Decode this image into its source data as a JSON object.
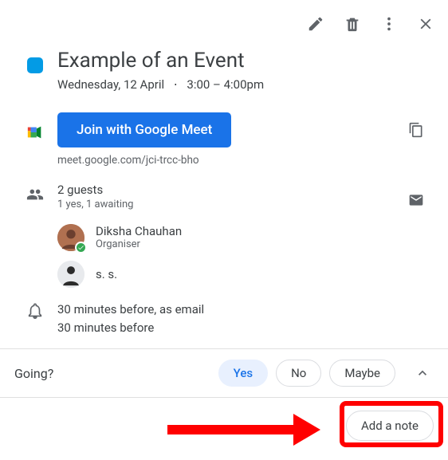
{
  "colors": {
    "event": "#039be5"
  },
  "event": {
    "title": "Example of an Event",
    "date": "Wednesday, 12 April",
    "time": "3:00 – 4:00pm"
  },
  "meet": {
    "join_label": "Join with Google Meet",
    "link": "meet.google.com/jci-trcc-bho"
  },
  "guests": {
    "count_line": "2 guests",
    "status_line": "1 yes, 1 awaiting",
    "items": [
      {
        "name": "Diksha Chauhan",
        "role": "Organiser",
        "response": "yes"
      },
      {
        "name": "s. s.",
        "role": "",
        "response": "awaiting"
      }
    ]
  },
  "notifications": {
    "lines": [
      "30 minutes before, as email",
      "30 minutes before"
    ]
  },
  "rsvp": {
    "prompt": "Going?",
    "options": {
      "yes": "Yes",
      "no": "No",
      "maybe": "Maybe"
    },
    "selected": "yes",
    "add_note_label": "Add a note"
  }
}
